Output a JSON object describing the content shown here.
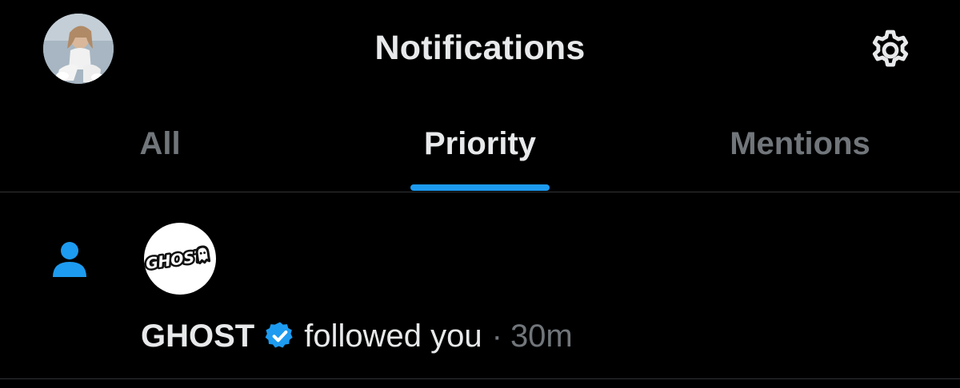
{
  "header": {
    "title": "Notifications",
    "avatar_icon": "profile-avatar",
    "settings_icon": "gear-icon"
  },
  "tabs": [
    {
      "label": "All",
      "active": false
    },
    {
      "label": "Priority",
      "active": true
    },
    {
      "label": "Mentions",
      "active": false
    }
  ],
  "notification": {
    "type_icon": "person-icon",
    "avatar_text": "GHOST",
    "actor": "GHOST",
    "verified_icon": "verified-badge-icon",
    "action": "followed you",
    "separator": "·",
    "time": "30m"
  },
  "colors": {
    "background": "#000000",
    "text_primary": "#e7e9ea",
    "text_secondary": "#71767b",
    "accent": "#1d9bf0",
    "divider": "#2f3336"
  }
}
